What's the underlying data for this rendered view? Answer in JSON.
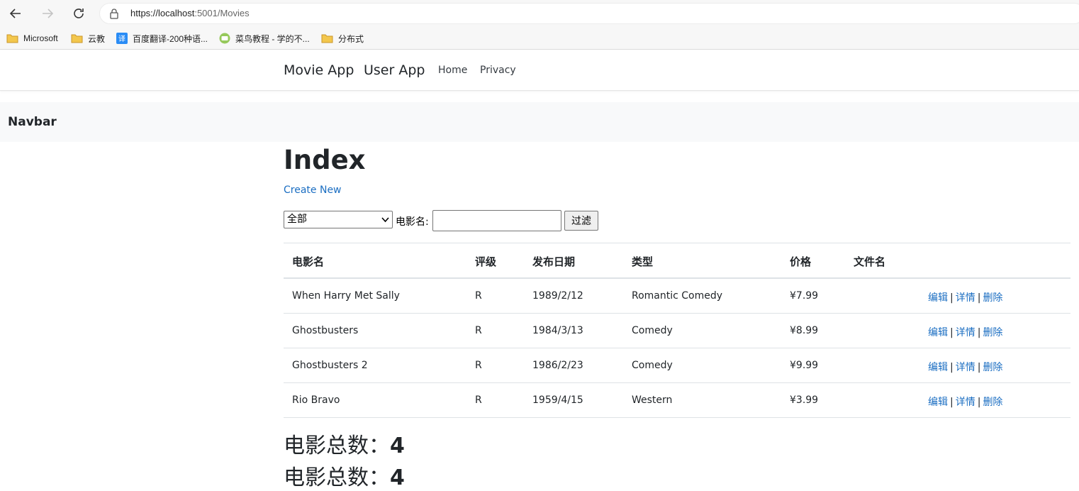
{
  "browser": {
    "url_host": "https://localhost",
    "url_rest": ":5001/Movies",
    "bookmarks": [
      {
        "label": "Microsoft",
        "icon": "folder-icon"
      },
      {
        "label": "云教",
        "icon": "folder-icon"
      },
      {
        "label": "百度翻译-200种语...",
        "icon": "translate-icon"
      },
      {
        "label": "菜鸟教程 - 学的不...",
        "icon": "runoob-icon"
      },
      {
        "label": "分布式",
        "icon": "folder-icon"
      }
    ]
  },
  "header": {
    "brand1": "Movie App",
    "brand2": "User App",
    "home": "Home",
    "privacy": "Privacy"
  },
  "navbar2": {
    "title": "Navbar"
  },
  "main": {
    "title": "Index",
    "create_new": "Create New",
    "filter": {
      "genre_selected": "全部",
      "title_label": "电影名:",
      "title_value": "",
      "button": "过滤"
    },
    "table": {
      "headers": [
        "电影名",
        "评级",
        "发布日期",
        "类型",
        "价格",
        "文件名"
      ],
      "rows": [
        {
          "title": "When Harry Met Sally",
          "rating": "R",
          "date": "1989/2/12",
          "genre": "Romantic Comedy",
          "price": "¥7.99",
          "file": ""
        },
        {
          "title": "Ghostbusters",
          "rating": "R",
          "date": "1984/3/13",
          "genre": "Comedy",
          "price": "¥8.99",
          "file": ""
        },
        {
          "title": "Ghostbusters 2",
          "rating": "R",
          "date": "1986/2/23",
          "genre": "Comedy",
          "price": "¥9.99",
          "file": ""
        },
        {
          "title": "Rio Bravo",
          "rating": "R",
          "date": "1959/4/15",
          "genre": "Western",
          "price": "¥3.99",
          "file": ""
        }
      ],
      "actions": {
        "edit": "编辑",
        "details": "详情",
        "delete": "删除",
        "separator": "|"
      }
    },
    "totals": [
      {
        "label": "电影总数：",
        "value": "4"
      },
      {
        "label": "电影总数：",
        "value": "4"
      }
    ]
  },
  "colors": {
    "link": "#1b6ec2",
    "navbar_bg": "#f8f9fa"
  }
}
